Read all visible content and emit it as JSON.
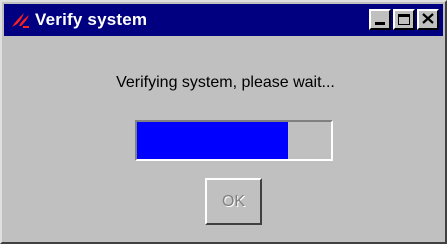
{
  "window": {
    "title": "Verify system",
    "icon": "tk-feather-icon",
    "controls": [
      "minimize-icon",
      "maximize-icon",
      "close-icon"
    ],
    "titlebar_color": "#000080"
  },
  "dialog": {
    "message": "Verifying system, please wait...",
    "progress_fraction": 0.78,
    "progress_color": "#0000ff",
    "ok_label": "OK",
    "ok_enabled": false
  }
}
